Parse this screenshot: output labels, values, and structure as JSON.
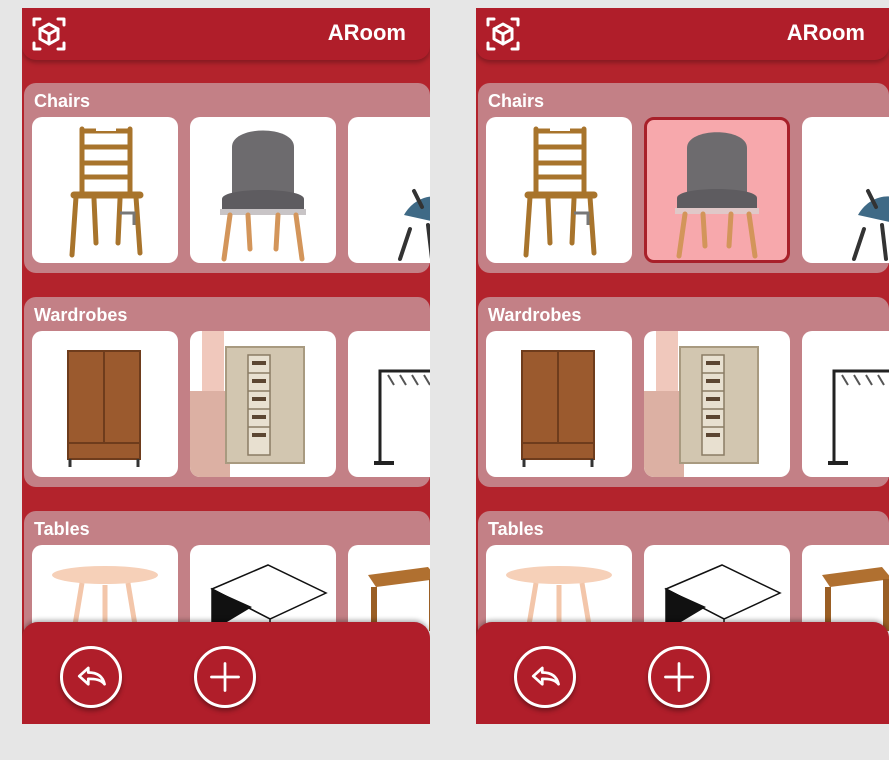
{
  "app": {
    "title": "ARoom"
  },
  "categories": [
    {
      "label": "Chairs"
    },
    {
      "label": "Wardrobes"
    },
    {
      "label": "Tables"
    }
  ],
  "colors": {
    "brand": "#b3232c",
    "selected_tile": "#f7a8ac"
  },
  "icons": {
    "ar": "ar-cube-icon",
    "undo": "undo-icon",
    "add": "plus-icon"
  }
}
